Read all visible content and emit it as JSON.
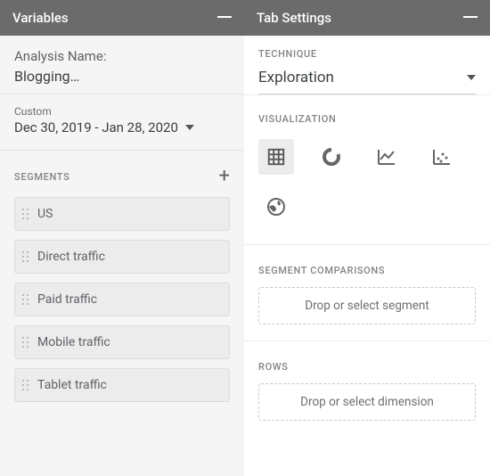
{
  "left": {
    "header": {
      "title": "Variables"
    },
    "analysis": {
      "label": "Analysis Name:",
      "value": "Blogging…"
    },
    "date": {
      "preset": "Custom",
      "range": "Dec 30, 2019 - Jan 28, 2020"
    },
    "segments": {
      "label": "SEGMENTS",
      "items": [
        {
          "label": "US"
        },
        {
          "label": "Direct traffic"
        },
        {
          "label": "Paid traffic"
        },
        {
          "label": "Mobile traffic"
        },
        {
          "label": "Tablet traffic"
        }
      ]
    }
  },
  "right": {
    "header": {
      "title": "Tab Settings"
    },
    "technique": {
      "label": "TECHNIQUE",
      "value": "Exploration"
    },
    "visualization": {
      "label": "VISUALIZATION",
      "options": [
        {
          "name": "table",
          "selected": true
        },
        {
          "name": "donut",
          "selected": false
        },
        {
          "name": "line",
          "selected": false
        },
        {
          "name": "scatter",
          "selected": false
        },
        {
          "name": "geo",
          "selected": false
        }
      ]
    },
    "segment_comparisons": {
      "label": "SEGMENT COMPARISONS",
      "placeholder": "Drop or select segment"
    },
    "rows": {
      "label": "ROWS",
      "placeholder": "Drop or select dimension"
    }
  }
}
